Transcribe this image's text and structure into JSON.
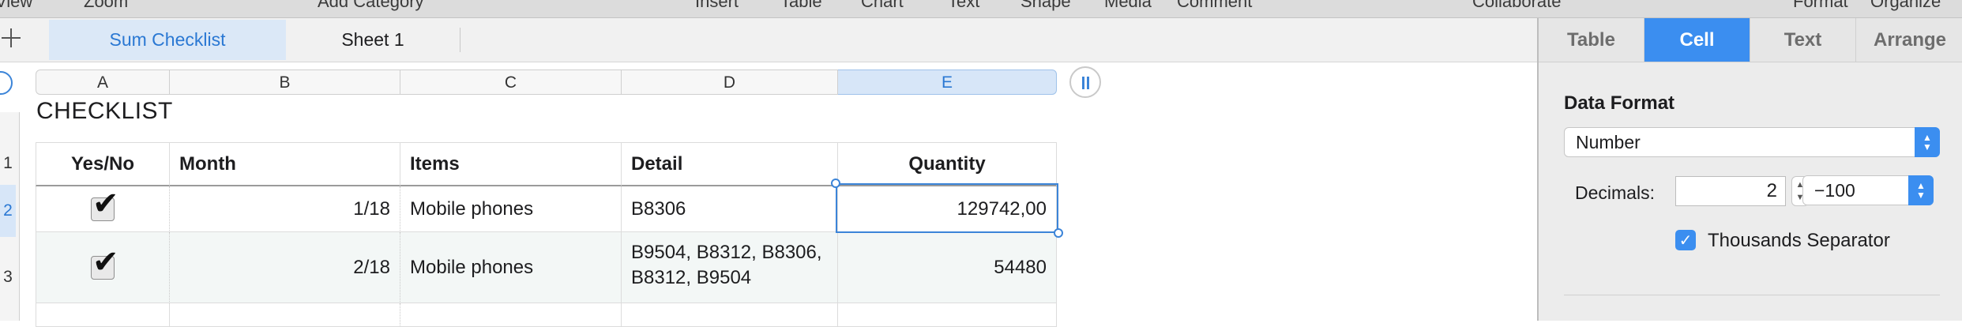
{
  "toolbar": {
    "items": [
      "View",
      "Zoom",
      "Add Category",
      "Insert",
      "Table",
      "Chart",
      "Text",
      "Shape",
      "Media",
      "Comment",
      "Collaborate",
      "Format",
      "Organize"
    ]
  },
  "sheets": {
    "active": "Sum Checklist",
    "inactive": "Sheet 1"
  },
  "columns": [
    "A",
    "B",
    "C",
    "D",
    "E"
  ],
  "rows": [
    "1",
    "2",
    "3"
  ],
  "table": {
    "title": "CHECKLIST",
    "headers": [
      "Yes/No",
      "Month",
      "Items",
      "Detail",
      "Quantity"
    ],
    "data": [
      {
        "checked": "✔",
        "month": "1/18",
        "items": "Mobile phones",
        "detail": "B8306",
        "quantity": "129742,00"
      },
      {
        "checked": "✔",
        "month": "2/18",
        "items": "Mobile phones",
        "detail": "B9504, B8312, B8306, B8312, B9504",
        "quantity": "54480"
      }
    ]
  },
  "inspector": {
    "tabs": [
      "Table",
      "Cell",
      "Text",
      "Arrange"
    ],
    "active_tab": "Cell",
    "data_format_label": "Data Format",
    "data_format_value": "Number",
    "decimals_label": "Decimals:",
    "decimals_value": "2",
    "negative_format": "−100",
    "thousands_label": "Thousands Separator",
    "thousands_checked": "✓"
  },
  "colors": {
    "accent": "#3b8ef0",
    "selection": "#d7e6f8",
    "row_alt": "#f3f7f6"
  }
}
